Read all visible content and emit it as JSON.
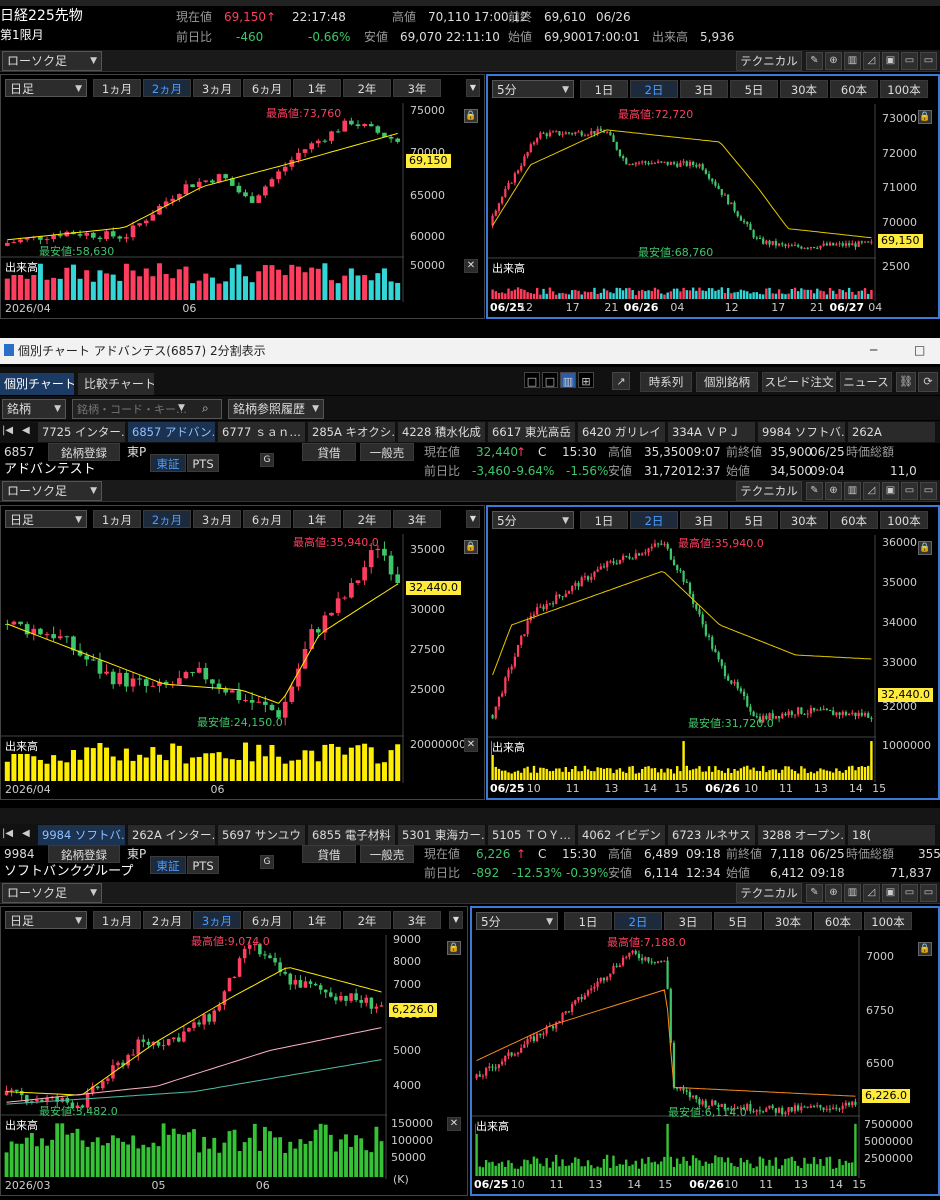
{
  "colors": {
    "up": "#ff3e5f",
    "down": "#3fc56a",
    "accent": "#3a7bd5",
    "price_box": "#ffeb3b",
    "vol_cyan": "#33d6d6",
    "vol_yellow": "#ffee00",
    "vol_green": "#36c236"
  },
  "nikkei": {
    "title": "日経225先物",
    "contract": "第1限月",
    "quote": {
      "cur_label": "現在値",
      "cur": "69,150",
      "arrow": "↑",
      "time": "22:17:48",
      "high_label": "高値",
      "high": "70,110",
      "high_time": "17:00:12",
      "prev_label": "前終",
      "prev": "69,610",
      "prev_date": "06/26",
      "chg_label": "前日比",
      "chg": "-460",
      "pct": "-0.66%",
      "low_label": "安値",
      "low": "69,070",
      "low_time": "22:11:10",
      "open_label": "始値",
      "open": "69,900",
      "open_time": "17:00:01",
      "vol_label": "出来高",
      "vol": "5,936"
    },
    "chart_type": "ローソク足",
    "left": {
      "period": "日足",
      "ranges": [
        "1ヵ月",
        "2ヵ月",
        "3ヵ月",
        "6ヵ月",
        "1年",
        "2年",
        "3年"
      ],
      "selected": 1,
      "y_ticks": [
        "75000",
        "70000",
        "65000",
        "60000"
      ],
      "price": "69,150",
      "max_label": "最高値:73,760",
      "min_label": "最安値:58,630",
      "vol_label": "出来高",
      "vol_tick": "50000",
      "x_labels": [
        "2026/04",
        "06"
      ]
    },
    "right": {
      "period": "5分",
      "ranges": [
        "1日",
        "2日",
        "3日",
        "5日",
        "30本",
        "60本",
        "100本"
      ],
      "selected": 1,
      "y_ticks": [
        "73000",
        "72000",
        "71000",
        "70000"
      ],
      "price": "69,150",
      "max_label": "最高値:72,720",
      "min_label": "最安値:68,760",
      "vol_label": "出来高",
      "vol_tick": "2500",
      "x_labels": [
        "06/25",
        "12",
        "17",
        "21",
        "06/26",
        "04",
        "12",
        "17",
        "21",
        "06/27",
        "04"
      ]
    }
  },
  "technical_label": "テクニカル",
  "window": {
    "title": "個別チャート アドバンテス(6857) 2分割表示",
    "tabs": [
      "個別チャート",
      "比較チャート"
    ],
    "right_btns": [
      "時系列",
      "個別銘柄",
      "スピード注文",
      "ニュース"
    ]
  },
  "search": {
    "type": "銘柄",
    "placeholder": "銘柄・コード・キー…",
    "history": "銘柄参照履歴"
  },
  "stock_tabs1": [
    "7725 インター…",
    "6857 アドバン…",
    "6777 ｓａｎ…",
    "285A キオクシ…",
    "4228 積水化成",
    "6617 東光高岳",
    "6420 ガリレイ",
    "334A ＶＰＪ",
    "9984 ソフトバ…",
    "262A"
  ],
  "stock_tabs2": [
    "9984 ソフトバ…",
    "262A インター…",
    "5697 サンユウ",
    "6855 電子材料",
    "5301 東海カー…",
    "5105 ＴＯＹ…",
    "4062 イビデン",
    "6723 ルネサス",
    "3288 オープン…",
    "18("
  ],
  "advantest": {
    "code": "6857",
    "name": "アドバンテスト",
    "reg": "銘柄登録",
    "market": "東P",
    "ex1": "東証",
    "ex2": "PTS",
    "g": "G",
    "margin": "貸借",
    "gen": "一般売",
    "quote": {
      "cur_label": "現在値",
      "cur": "32,440",
      "arrow": "↑",
      "c": "C",
      "time": "15:30",
      "high_label": "高値",
      "high": "35,350",
      "high_time": "09:07",
      "prev_label": "前終値",
      "prev": "35,900",
      "prev_date": "06/25",
      "cap_label": "時価総額",
      "chg_label": "前日比",
      "chg": "-3,460",
      "pct": "-9.64%",
      "pct2": "-1.56%",
      "low_label": "安値",
      "low": "31,720",
      "low_time": "12:37",
      "open_label": "始値",
      "open": "34,500",
      "open_time": "09:04",
      "cap": "11,0"
    },
    "chart_type": "ローソク足",
    "left": {
      "period": "日足",
      "ranges": [
        "1ヵ月",
        "2ヵ月",
        "3ヵ月",
        "6ヵ月",
        "1年",
        "2年",
        "3年"
      ],
      "selected": 1,
      "y_ticks": [
        "35000",
        "30000",
        "27500",
        "25000"
      ],
      "price": "32,440.0",
      "max_label": "最高値:35,940.0",
      "min_label": "最安値:24,150.0",
      "vol_label": "出来高",
      "vol_tick": "20000000",
      "x_labels": [
        "2026/04",
        "06"
      ]
    },
    "right": {
      "period": "5分",
      "ranges": [
        "1日",
        "2日",
        "3日",
        "5日",
        "30本",
        "60本",
        "100本"
      ],
      "selected": 1,
      "y_ticks": [
        "36000",
        "35000",
        "34000",
        "33000",
        "32000"
      ],
      "price": "32,440.0",
      "max_label": "最高値:35,940.0",
      "min_label": "最安値:31,720.0",
      "vol_label": "出来高",
      "vol_tick": "1000000",
      "x_labels": [
        "06/25",
        "10",
        "11",
        "13",
        "14",
        "15",
        "06/26",
        "10",
        "11",
        "13",
        "14",
        "15"
      ]
    }
  },
  "softbank": {
    "code": "9984",
    "name": "ソフトバンクグループ",
    "reg": "銘柄登録",
    "market": "東P",
    "ex1": "東証",
    "ex2": "PTS",
    "g": "G",
    "margin": "貸借",
    "gen": "一般売",
    "quote": {
      "cur_label": "現在値",
      "cur": "6,226",
      "arrow": "↑",
      "c": "C",
      "time": "15:30",
      "high_label": "高値",
      "high": "6,489",
      "high_time": "09:18",
      "prev_label": "前終値",
      "prev": "7,118",
      "prev_date": "06/25",
      "cap_label": "時価総額",
      "cap_top": "355",
      "chg_label": "前日比",
      "chg": "-892",
      "pct": "-12.53%",
      "pct2": "-0.39%",
      "low_label": "安値",
      "low": "6,114",
      "low_time": "12:34",
      "open_label": "始値",
      "open": "6,412",
      "open_time": "09:18",
      "cap": "71,837"
    },
    "chart_type": "ローソク足",
    "left": {
      "period": "日足",
      "ranges": [
        "1ヵ月",
        "2ヵ月",
        "3ヵ月",
        "6ヵ月",
        "1年",
        "2年",
        "3年"
      ],
      "selected": 2,
      "y_ticks": [
        "9000",
        "8000",
        "7000",
        "6000",
        "5000",
        "4000"
      ],
      "price": "6,226.0",
      "max_label": "最高値:9,074.0",
      "min_label": "最安値:3,482.0",
      "vol_label": "出来高",
      "vol_ticks": [
        "150000",
        "100000",
        "50000"
      ],
      "vol_unit": "(K)",
      "x_labels": [
        "2026/03",
        "05",
        "06"
      ]
    },
    "right": {
      "period": "5分",
      "ranges": [
        "1日",
        "2日",
        "3日",
        "5日",
        "30本",
        "60本",
        "100本"
      ],
      "selected": 1,
      "y_ticks": [
        "7000",
        "6750",
        "6500"
      ],
      "price": "6,226.0",
      "max_label": "最高値:7,188.0",
      "min_label": "最安値:6,114.0",
      "vol_label": "出来高",
      "vol_ticks": [
        "7500000",
        "5000000",
        "2500000"
      ],
      "x_labels": [
        "06/25",
        "10",
        "11",
        "13",
        "14",
        "15",
        "06/26",
        "10",
        "11",
        "13",
        "14",
        "15"
      ]
    }
  }
}
